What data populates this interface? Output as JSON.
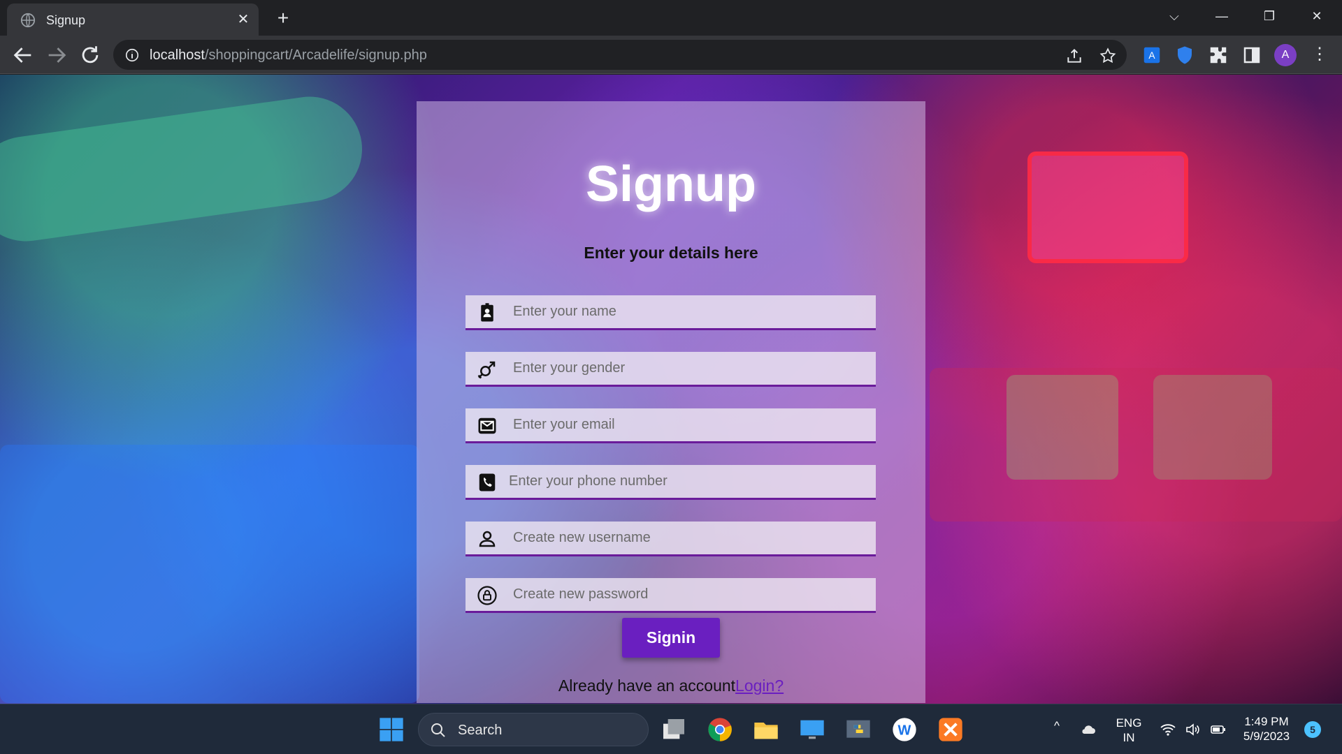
{
  "browser": {
    "tab_title": "Signup",
    "url_host": "localhost",
    "url_path": "/shoppingcart/Arcadelife/signup.php",
    "profile_initial": "A"
  },
  "page": {
    "title": "Signup",
    "subtitle": "Enter your details here",
    "fields": [
      {
        "placeholder": "Enter your name",
        "icon": "id-badge-icon"
      },
      {
        "placeholder": "Enter your gender",
        "icon": "gender-icon"
      },
      {
        "placeholder": "Enter your email",
        "icon": "envelope-icon"
      },
      {
        "placeholder": "Enter your phone number",
        "icon": "phone-icon"
      },
      {
        "placeholder": "Create new username",
        "icon": "user-icon"
      },
      {
        "placeholder": "Create new password",
        "icon": "lock-icon"
      }
    ],
    "submit_label": "Signin",
    "login_prompt": "Already have an account",
    "login_link": "Login?"
  },
  "taskbar": {
    "search_label": "Search",
    "language_line1": "ENG",
    "language_line2": "IN",
    "time": "1:49 PM",
    "date": "5/9/2023",
    "notification_count": "5"
  },
  "colors": {
    "accent": "#6a1fc0",
    "field_underline": "#6a1b9a"
  }
}
